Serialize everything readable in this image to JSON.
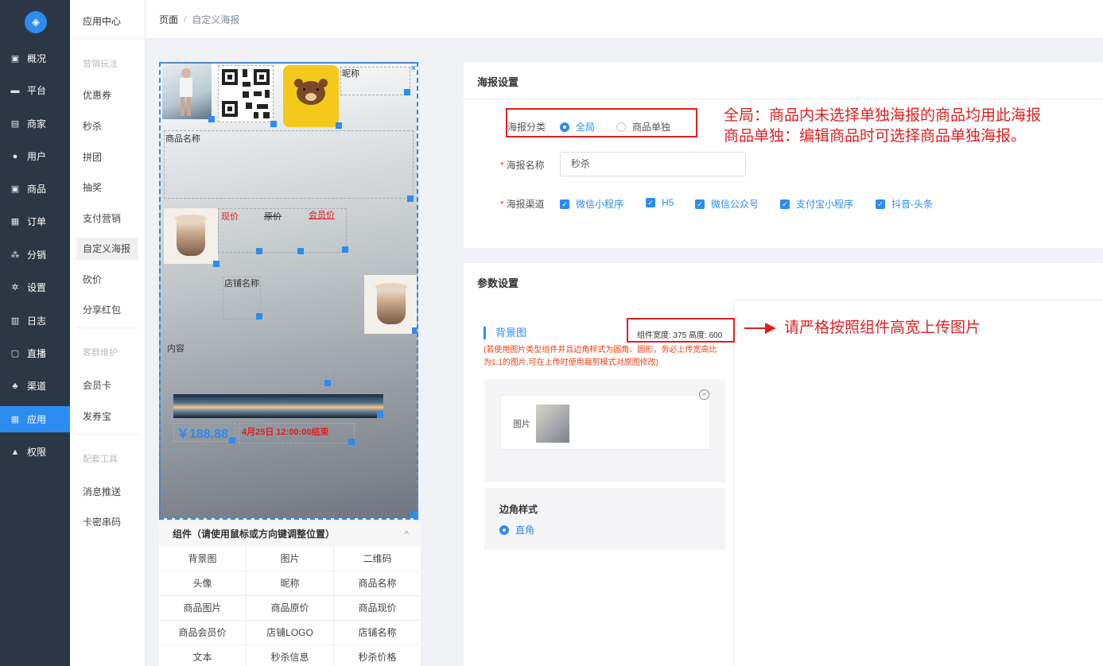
{
  "nav": {
    "items": [
      {
        "label": "概况",
        "icon": "monitor-icon"
      },
      {
        "label": "平台",
        "icon": "desktop-icon"
      },
      {
        "label": "商家",
        "icon": "shop-icon"
      },
      {
        "label": "用户",
        "icon": "user-icon"
      },
      {
        "label": "商品",
        "icon": "goods-icon"
      },
      {
        "label": "订单",
        "icon": "order-icon"
      },
      {
        "label": "分销",
        "icon": "distribution-icon"
      },
      {
        "label": "设置",
        "icon": "gear-icon"
      },
      {
        "label": "日志",
        "icon": "log-icon"
      },
      {
        "label": "直播",
        "icon": "live-icon"
      },
      {
        "label": "渠道",
        "icon": "channel-icon"
      },
      {
        "label": "应用",
        "icon": "apps-icon"
      },
      {
        "label": "权限",
        "icon": "lock-icon"
      }
    ],
    "active": "应用"
  },
  "submenu": {
    "title": "应用中心",
    "group1": "营销玩法",
    "g1": [
      "优惠券",
      "秒杀",
      "拼团",
      "抽奖",
      "支付营销",
      "自定义海报",
      "砍价",
      "分享红包"
    ],
    "group2": "客群维护",
    "g2": [
      "会员卡",
      "发券宝"
    ],
    "group3": "配套工具",
    "g3": [
      "消息推送",
      "卡密串码"
    ],
    "active": "自定义海报"
  },
  "breadcrumb": {
    "root": "页面",
    "sep": "/",
    "current": "自定义海报"
  },
  "poster": {
    "nickname": "昵称",
    "goods_name": "商品名称",
    "now_price": "现价",
    "orig_price": "原价",
    "member_price": "会员价",
    "shop_name": "店铺名称",
    "content": "内容",
    "price": "￥188.88",
    "end_time": "4月25日 12:00:00结束",
    "close": "×"
  },
  "components": {
    "title": "组件（请使用鼠标或方向键调整位置）",
    "collapse": "^",
    "items": [
      "背景图",
      "图片",
      "二维码",
      "头像",
      "昵称",
      "商品名称",
      "商品图片",
      "商品原价",
      "商品现价",
      "商品会员价",
      "店铺LOGO",
      "店铺名称",
      "文本",
      "秒杀信息",
      "秒杀价格"
    ]
  },
  "poster_settings": {
    "title": "海报设置",
    "type_label": "海报分类",
    "type_options": [
      "全局",
      "商品单独"
    ],
    "type_selected": "全局",
    "name_label": "海报名称",
    "name_value": "秒杀",
    "channel_label": "海报渠道",
    "channels": [
      "微信小程序",
      "H5",
      "微信公众号",
      "支付宝小程序",
      "抖音-头条"
    ],
    "required_mark": "*"
  },
  "param_settings": {
    "title": "参数设置",
    "bg_title": "背景图",
    "size_info": "组件宽度: 375 高度: 600",
    "hint": "(若使用图片类型组件并且边角样式为圆角、圆形，务必上传宽高比为1:1的图片,可在上传时使用裁剪模式对原图修改)",
    "image_label": "图片",
    "corner_title": "边角样式",
    "corner_option": "直角"
  },
  "annotations": {
    "note1_line1": "全局：商品内未选择单独海报的商品均用此海报",
    "note1_line2": "商品单独：编辑商品时可选择商品单独海报。",
    "note2": "请严格按照组件高宽上传图片"
  },
  "colors": {
    "accent": "#2d8cf0",
    "sidebar": "#2b3744",
    "annotation": "#e02020",
    "price": "#2d8cf0",
    "time": "#e02020"
  }
}
